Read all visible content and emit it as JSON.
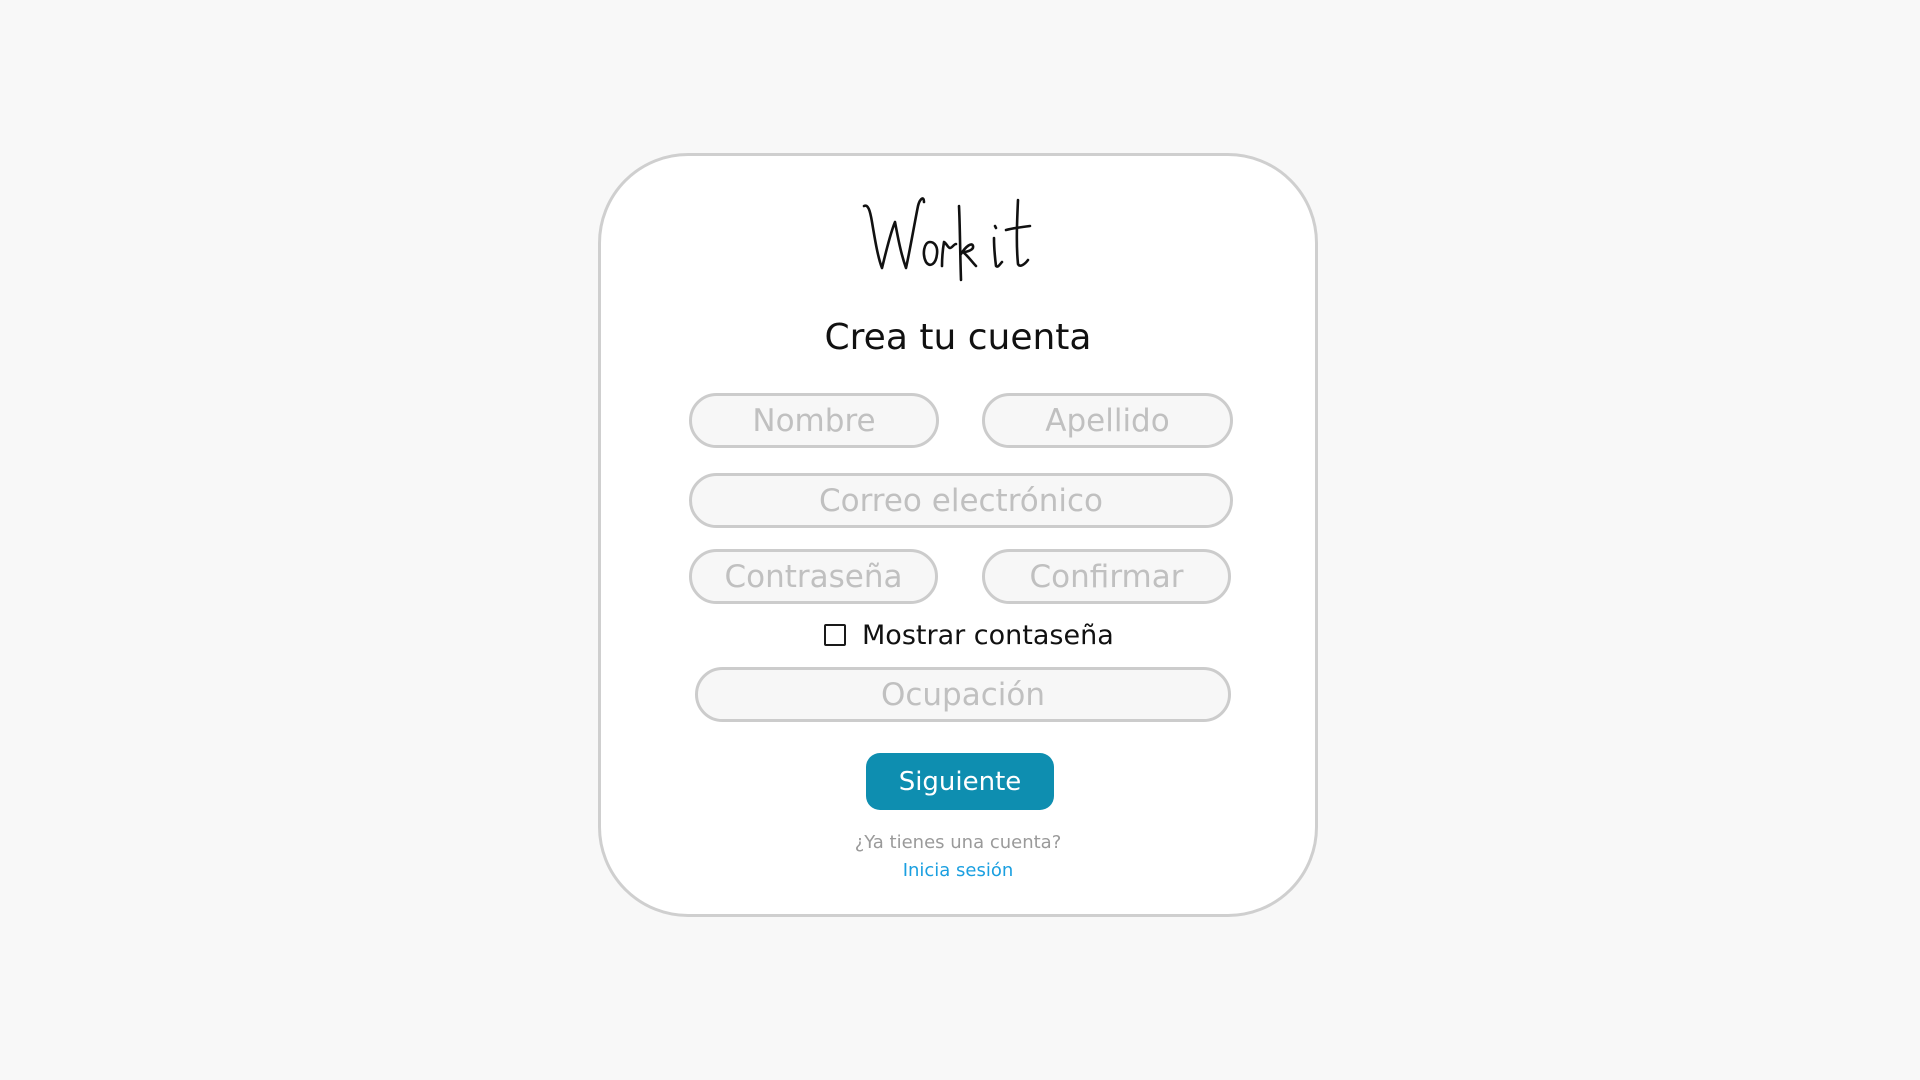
{
  "logo": {
    "text": "Work it"
  },
  "form": {
    "title": "Crea tu cuenta",
    "fields": {
      "first_name": {
        "placeholder": "Nombre",
        "value": ""
      },
      "last_name": {
        "placeholder": "Apellido",
        "value": ""
      },
      "email": {
        "placeholder": "Correo electrónico",
        "value": ""
      },
      "password": {
        "placeholder": "Contraseña",
        "value": ""
      },
      "confirm": {
        "placeholder": "Confirmar",
        "value": ""
      },
      "occupation": {
        "placeholder": "Ocupación",
        "value": ""
      }
    },
    "show_password": {
      "label": "Mostrar contaseña",
      "checked": false
    },
    "next_button": "Siguiente",
    "have_account": "¿Ya tienes una cuenta?",
    "login_link": "Inicia sesión"
  },
  "colors": {
    "background": "#f8f8f8",
    "card": "#ffffff",
    "border": "#cfcfcf",
    "primary_button": "#0e8eb0",
    "link": "#1a9fe0",
    "placeholder": "#c0c0c0"
  }
}
